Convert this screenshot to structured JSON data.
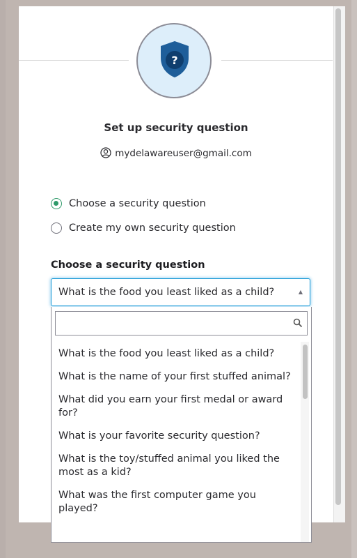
{
  "header": {
    "title": "Set up security question",
    "identity": "mydelawareuser@gmail.com",
    "icons": {
      "avatar": "shield-question-icon",
      "identity": "user-circle-icon"
    }
  },
  "form": {
    "radio_options": [
      {
        "label": "Choose a security question",
        "selected": true
      },
      {
        "label": "Create my own security question",
        "selected": false
      }
    ],
    "field_label": "Choose a security question",
    "select_value": "What is the food you least liked as a child?",
    "search_placeholder": "",
    "options": [
      "What is the food you least liked as a child?",
      "What is the name of your first stuffed animal?",
      "What did you earn your first medal or award for?",
      "What is your favorite security question?",
      "What is the toy/stuffed animal you liked the most as a kid?",
      "What was the first computer game you played?"
    ]
  },
  "colors": {
    "accent": "#1a9ad6",
    "radio": "#2f9a6a",
    "shield": "#1e5e9a",
    "avatar_bg": "#ddeefa"
  }
}
